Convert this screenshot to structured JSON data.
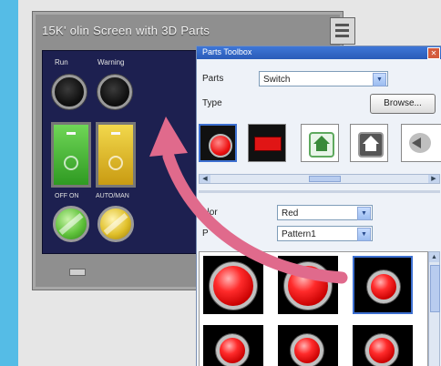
{
  "hmi": {
    "title": "15K' olin Screen with 3D Parts",
    "lamps": [
      {
        "label": "Run"
      },
      {
        "label": "Warning"
      }
    ],
    "switch_labels": {
      "green": "OFF  ON",
      "yellow": "AUTO/MAN"
    }
  },
  "toolbox": {
    "title": "Parts Toolbox",
    "close_glyph": "✕",
    "parts_label": "Parts",
    "parts_value": "Switch",
    "type_label": "Type",
    "browse_label": "Browse...",
    "color_label": "olor",
    "color_value": "Red",
    "pattern_label": "P",
    "pattern_value": "Pattern1",
    "icons": [
      "red-round-button-icon",
      "red-rect-button-icon",
      "green-home-icon",
      "dark-home-icon",
      "left-arrow-icon"
    ]
  },
  "colors": {
    "background": "#55bce6",
    "accent_arrow": "#e06a8c",
    "screen": "#1d2050"
  }
}
